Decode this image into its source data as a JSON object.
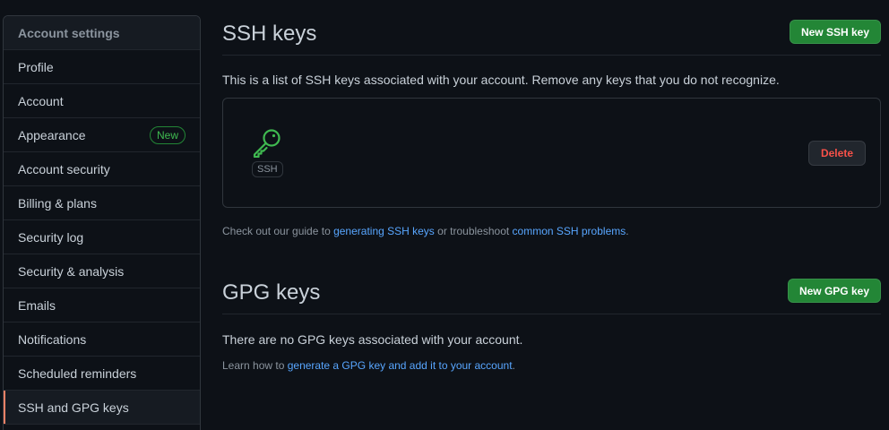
{
  "sidebar": {
    "header": "Account settings",
    "items": [
      {
        "label": "Profile"
      },
      {
        "label": "Account"
      },
      {
        "label": "Appearance",
        "badge": "New"
      },
      {
        "label": "Account security"
      },
      {
        "label": "Billing & plans"
      },
      {
        "label": "Security log"
      },
      {
        "label": "Security & analysis"
      },
      {
        "label": "Emails"
      },
      {
        "label": "Notifications"
      },
      {
        "label": "Scheduled reminders"
      },
      {
        "label": "SSH and GPG keys",
        "selected": true
      }
    ]
  },
  "ssh": {
    "title": "SSH keys",
    "new_button": "New SSH key",
    "description": "This is a list of SSH keys associated with your account. Remove any keys that you do not recognize.",
    "key": {
      "icon": "key-icon",
      "type_label": "SSH",
      "delete_button": "Delete"
    },
    "guide_prefix": "Check out our guide to ",
    "guide_link": "generating SSH keys",
    "guide_middle": " or troubleshoot ",
    "troubleshoot_link": "common SSH problems",
    "guide_suffix": "."
  },
  "gpg": {
    "title": "GPG keys",
    "new_button": "New GPG key",
    "empty_text": "There are no GPG keys associated with your account.",
    "learn_prefix": "Learn how to ",
    "learn_link": "generate a GPG key and add it to your account",
    "learn_suffix": "."
  },
  "colors": {
    "background": "#0d1117",
    "primary_button": "#238636",
    "danger_text": "#f85149",
    "link": "#58a6ff",
    "selected_indicator": "#f78166",
    "key_icon": "#3fb950"
  }
}
